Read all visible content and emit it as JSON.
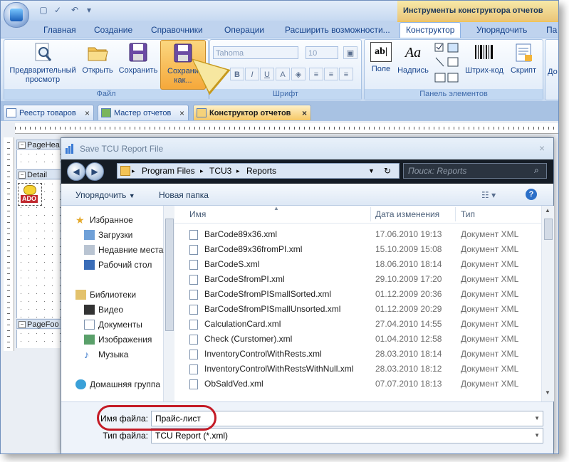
{
  "window": {
    "context_title": "Инструменты конструктора отчетов"
  },
  "ribbon": {
    "tabs": [
      "Главная",
      "Создание",
      "Справочники",
      "Операции",
      "Расширить возможности...",
      "Конструктор",
      "Упорядочить",
      "Па"
    ],
    "active_tab": "Конструктор",
    "file_group": {
      "label": "Файл",
      "buttons": [
        {
          "line1": "Предварительный",
          "line2": "просмотр"
        },
        {
          "line1": "Открыть",
          "line2": ""
        },
        {
          "line1": "Сохранить",
          "line2": ""
        },
        {
          "line1": "Сохрани",
          "line2": "как..."
        }
      ]
    },
    "font_group": {
      "label": "Шрифт",
      "font_name": "Tahoma",
      "font_size": "10",
      "bold": "B",
      "italic": "I",
      "underline": "U",
      "color": "A"
    },
    "elements_group": {
      "label": "Панель элементов",
      "buttons": [
        "Поле",
        "Надпись",
        "Штрих-код",
        "Скрипт",
        "До"
      ],
      "field_icon_text": "ab|",
      "label_icon_text": "Aa"
    }
  },
  "doc_tabs": [
    {
      "label": "Реестр товаров",
      "close": "×"
    },
    {
      "label": "Мастер отчетов",
      "close": "×"
    },
    {
      "label": "Конструктор отчетов",
      "close": "×"
    }
  ],
  "designer": {
    "bands": [
      "PageHea",
      "Detail",
      "PageFoo"
    ],
    "ado_label": "ADO"
  },
  "dialog": {
    "title": "Save TCU Report File",
    "close": "×",
    "path": [
      "Program Files",
      "TCU3",
      "Reports"
    ],
    "search_placeholder": "Поиск: Reports",
    "toolbar": {
      "organize": "Упорядочить",
      "new_folder": "Новая папка"
    },
    "nav": {
      "favorites": "Избранное",
      "downloads": "Загрузки",
      "recent": "Недавние места",
      "desktop": "Рабочий стол",
      "libraries": "Библиотеки",
      "video": "Видео",
      "documents": "Документы",
      "images": "Изображения",
      "music": "Музыка",
      "homegroup": "Домашняя группа"
    },
    "columns": {
      "name": "Имя",
      "date": "Дата изменения",
      "type": "Тип"
    },
    "files": [
      {
        "name": "BarCode89x36.xml",
        "date": "17.06.2010 19:13",
        "type": "Документ XML"
      },
      {
        "name": "BarCode89x36fromPI.xml",
        "date": "15.10.2009 15:08",
        "type": "Документ XML"
      },
      {
        "name": "BarCodeS.xml",
        "date": "18.06.2010 18:14",
        "type": "Документ XML"
      },
      {
        "name": "BarCodeSfromPI.xml",
        "date": "29.10.2009 17:20",
        "type": "Документ XML"
      },
      {
        "name": "BarCodeSfromPISmallSorted.xml",
        "date": "01.12.2009 20:36",
        "type": "Документ XML"
      },
      {
        "name": "BarCodeSfromPISmallUnsorted.xml",
        "date": "01.12.2009 20:29",
        "type": "Документ XML"
      },
      {
        "name": "CalculationCard.xml",
        "date": "27.04.2010 14:55",
        "type": "Документ XML"
      },
      {
        "name": "Check (Curstomer).xml",
        "date": "01.04.2010 12:58",
        "type": "Документ XML"
      },
      {
        "name": "InventoryControlWithRests.xml",
        "date": "28.03.2010 18:14",
        "type": "Документ XML"
      },
      {
        "name": "InventoryControlWithRestsWithNull.xml",
        "date": "28.03.2010 18:12",
        "type": "Документ XML"
      },
      {
        "name": "ObSaldVed.xml",
        "date": "07.07.2010 18:13",
        "type": "Документ XML"
      }
    ],
    "filename_label": "Имя файла:",
    "filename_value": "Прайс-лист",
    "filetype_label": "Тип файла:",
    "filetype_value": "TCU Report (*.xml)"
  },
  "colors": {
    "ribbon_bg": "#dbe7f6",
    "context_tab": "#eac67a",
    "highlight_oval": "#c41b26",
    "active_doc_tab": "#f6c865"
  }
}
